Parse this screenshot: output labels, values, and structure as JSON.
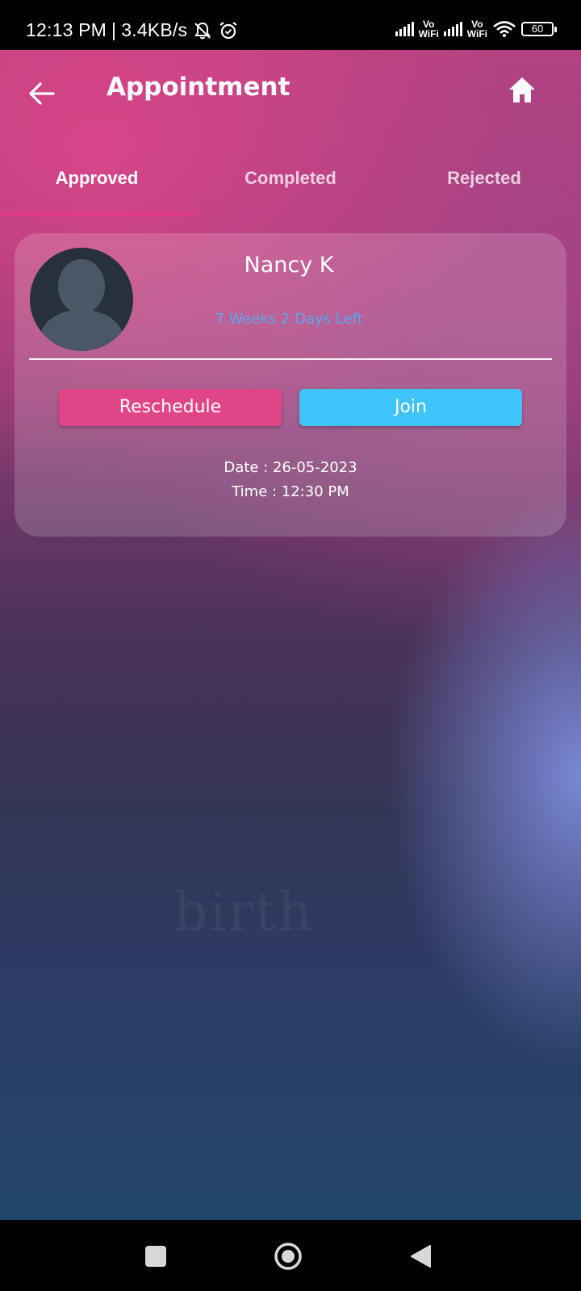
{
  "status_bar": {
    "time": "12:13 PM",
    "separator": "|",
    "speed": "3.4KB/s",
    "vowifi_1_line1": "Vo",
    "vowifi_1_line2": "WiFi",
    "vowifi_2_line1": "Vo",
    "vowifi_2_line2": "WiFi",
    "battery": "60",
    "icons": [
      "bell-muted-icon",
      "alarm-icon",
      "signal-icon",
      "wifi-icon",
      "battery-icon"
    ]
  },
  "header": {
    "title": "Appointment",
    "icons": [
      "back-arrow-icon",
      "home-icon"
    ]
  },
  "tabs": [
    {
      "label": "Approved",
      "active": true
    },
    {
      "label": "Completed",
      "active": false
    },
    {
      "label": "Rejected",
      "active": false
    }
  ],
  "appointment": {
    "name": "Nancy K",
    "time_left": "7 Weeks 2 Days Left",
    "reschedule_label": "Reschedule",
    "join_label": "Join",
    "date_line": "Date : 26-05-2023",
    "time_line": "Time : 12:30 PM"
  },
  "watermark": "birth",
  "colors": {
    "tab_indicator": "#e53888",
    "reschedule": "#e04687",
    "join": "#3fc3fb",
    "time_left_text": "#5aa8ee"
  },
  "nav_icons": [
    "recent-apps-icon",
    "home-circle-icon",
    "back-triangle-icon"
  ]
}
